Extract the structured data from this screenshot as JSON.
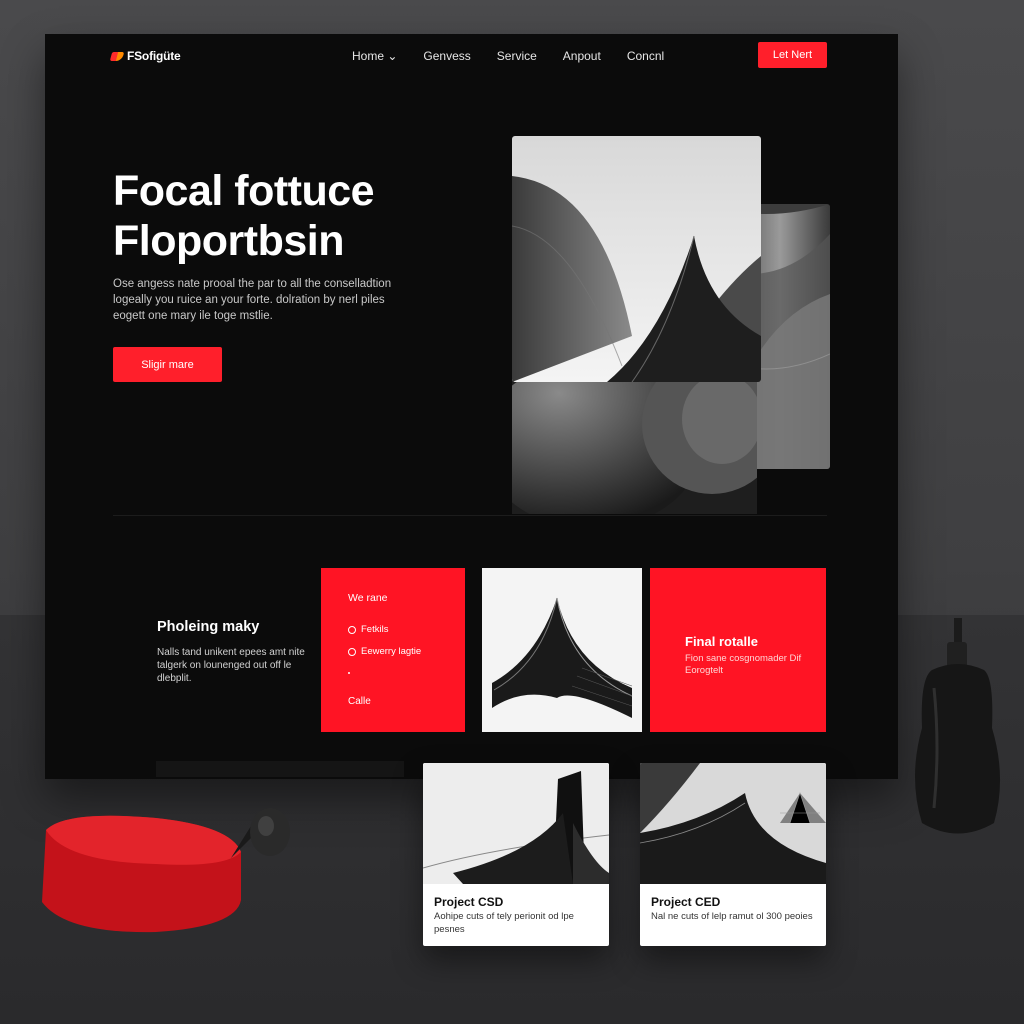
{
  "brand": {
    "name": "FSofigüte"
  },
  "nav": {
    "items": [
      "Home ⌄",
      "Genvess",
      "Service",
      "Anpout",
      "Concnl"
    ],
    "cta": "Let Nert"
  },
  "hero": {
    "title_line1": "Focal fottuce",
    "title_line2": "Floportbsin",
    "body": "Ose angess nate prooal the par to all the conselladtion logeally you ruice an your forte. dolration by nerl piles eogett one mary ile toge mstlie.",
    "button": "Sligir mare"
  },
  "features": {
    "title": "Pholeing maky",
    "body": "Nalls tand unikent epees amt nite talgerk on lounenged out off le dlebplit."
  },
  "card_red1": {
    "heading": "We rane",
    "items": [
      "Fetkils",
      "Eewerry lagtie"
    ],
    "footer": "Calle"
  },
  "card_red2": {
    "title": "Final rotalle",
    "body": "Fion sane cosgnomader Dif Eorogtelt"
  },
  "projects": [
    {
      "title": "Project CSD",
      "body": "Aohipe cuts of tely perionit od lpe pesnes"
    },
    {
      "title": "Project CED",
      "body": "Nal ne cuts of lelp ramut ol 300 peoies"
    }
  ],
  "colors": {
    "accent": "#ff1f2b",
    "screen_bg": "#0b0b0b",
    "backdrop": "#434345"
  },
  "icons": [
    "circle-icon",
    "circle-icon"
  ]
}
